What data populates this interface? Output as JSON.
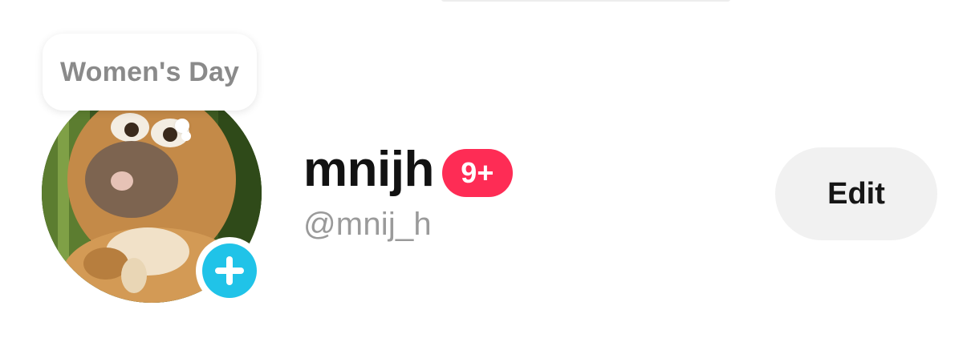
{
  "status_bubble": {
    "text": "Women's Day"
  },
  "profile": {
    "display_name": "mnijh",
    "notification_badge": "9+",
    "username": "@mnij_h",
    "avatar_description_icon": "bear-cartoon-avatar",
    "add_icon": "plus-icon"
  },
  "actions": {
    "edit_label": "Edit"
  },
  "colors": {
    "badge": "#fe2c55",
    "add_button": "#20c3e8",
    "edit_button_bg": "#f1f1f1",
    "handle_text": "#9a9a9a",
    "bubble_text": "#8a8a8a"
  }
}
